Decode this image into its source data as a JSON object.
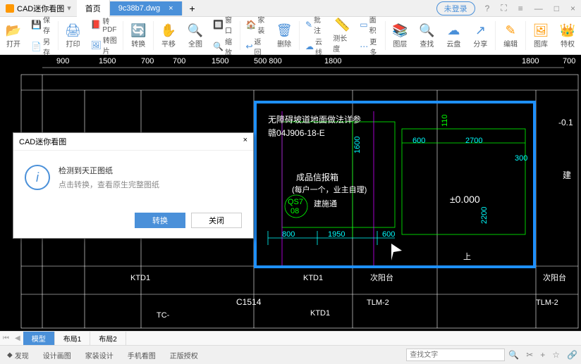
{
  "titlebar": {
    "app": "CAD迷你看图",
    "tabs": [
      {
        "label": "首页"
      },
      {
        "label": "9c38b7.dwg"
      }
    ],
    "login": "未登录"
  },
  "toolbar": {
    "open": "打开",
    "save": "保存",
    "saveas": "另存",
    "print": "打印",
    "pdf": "转PDF",
    "img": "转图片",
    "convert": "转换",
    "pan": "平移",
    "fit": "全图",
    "window": "窗口",
    "zoom": "缩放",
    "home": "家装",
    "return": "返回",
    "delete": "删除",
    "annotate": "批注",
    "cloud_line": "云线",
    "measure": "测长度",
    "area": "面积",
    "more": "更多",
    "layer": "图层",
    "find": "查找",
    "clouddisk": "云盘",
    "share": "分享",
    "edit": "编辑",
    "gallery": "图库",
    "privilege": "特权"
  },
  "dialog": {
    "title": "CAD迷你看图",
    "line1": "检测到天正图纸",
    "line2": "点击转换，查看原生完整图纸",
    "convert": "转换",
    "close": "关闭"
  },
  "drawing": {
    "ruler": [
      "900",
      "1500",
      "700",
      "700",
      "1500",
      "500 800",
      "1800",
      "1800",
      "700"
    ],
    "text1": "无障碍坡道地面做法详参",
    "text2": "赣04J906-18-E",
    "text3": "成品信报箱",
    "text4": "(每户一个，业主自理)",
    "text5": "建施通",
    "text6a": "QS7",
    "text6b": "08",
    "text7": "±0.000",
    "text8": "-0.1",
    "text9": "建",
    "dim_1600": "1600",
    "dim_600a": "600",
    "dim_2700": "2700",
    "dim_300": "300",
    "dim_800": "800",
    "dim_1950": "1950",
    "dim_600b": "600",
    "dim_2200": "2200",
    "dim_110": "110",
    "ktd1": "KTD1",
    "ktd1b": "KTD1",
    "ktd1c": "KTD1",
    "sub_balcony": "次阳台",
    "sub_balcony2": "次阳台",
    "c1514": "C1514",
    "tlm2": "TLM-2",
    "tlm2b": "TLM-2",
    "tc": "TC-",
    "up": "上"
  },
  "layout_tabs": {
    "model": "模型",
    "layout1": "布局1",
    "layout2": "布局2"
  },
  "statusbar": {
    "discover": "发现",
    "design": "设计画图",
    "decor": "家装设计",
    "mobile": "手机看图",
    "genuine": "正版授权",
    "search_placeholder": "查找文字"
  }
}
